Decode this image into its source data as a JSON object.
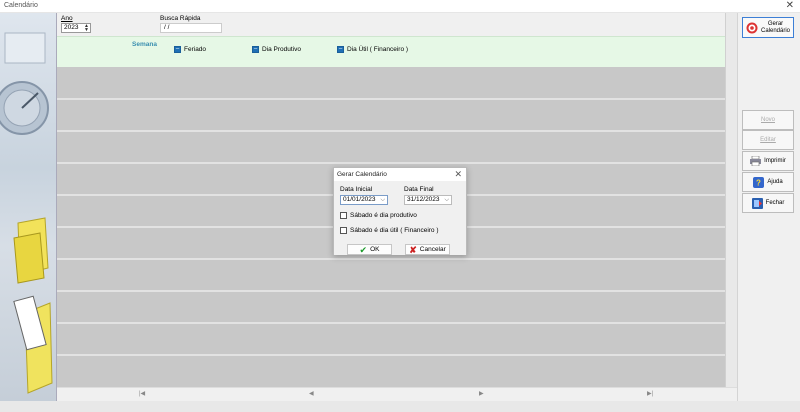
{
  "window": {
    "title": "Calendário",
    "close_glyph": "✕"
  },
  "filters": {
    "year_label": "Ano",
    "year_value": "2023",
    "quick_search_label": "Busca Rápida",
    "quick_search_value": " /  /"
  },
  "legend": {
    "title": "Semana",
    "items": [
      {
        "label": "Feriado",
        "color": "#1f6fb5"
      },
      {
        "label": "Dia Produtivo",
        "color": "#1f6fb5"
      },
      {
        "label": "Dia Útil ( Financeiro )",
        "color": "#1f6fb5"
      }
    ]
  },
  "right_panel": {
    "generate_label": "Gerar\nCalendário",
    "novo_label": "Novo",
    "editar_label": "Editar",
    "imprimir_label": "Imprimir",
    "ajuda_label": "Ajuda",
    "fechar_label": "Fechar",
    "icons": [
      "target-icon",
      "printer-icon",
      "help-icon",
      "exit-icon"
    ]
  },
  "nav": {
    "first": "|◀",
    "prev": "◀",
    "next": "▶",
    "last": "▶|"
  },
  "dialog": {
    "title": "Gerar Calendário",
    "close_glyph": "✕",
    "start_label": "Data Inicial",
    "start_value": "01/01/2023",
    "end_label": "Data Final",
    "end_value": "31/12/2023",
    "chk_saturday_productive": "Sábado é dia produtivo",
    "chk_saturday_business": "Sábado é dia útil ( Financeiro )",
    "ok_label": "OK",
    "cancel_label": "Cancelar"
  }
}
